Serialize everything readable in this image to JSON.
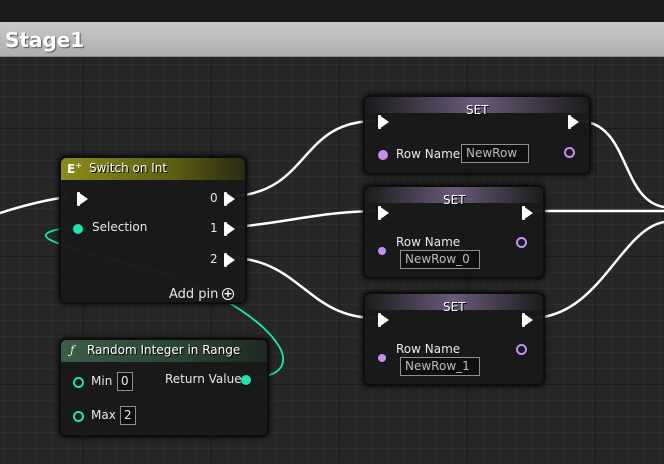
{
  "comment": {
    "title": "Stage1"
  },
  "switch_node": {
    "title": "Switch on Int",
    "icon": "switch-icon",
    "pins": [
      "0",
      "1",
      "2"
    ],
    "selection_label": "Selection",
    "add_pin_label": "Add pin",
    "add_pin_icon": "+"
  },
  "random_node": {
    "title": "Random Integer in Range",
    "icon_glyph": "ƒ",
    "min_label": "Min",
    "min_value": "0",
    "max_label": "Max",
    "max_value": "2",
    "return_label": "Return Value"
  },
  "set_nodes": [
    {
      "title": "SET",
      "row_label": "Row Name",
      "row_value": "NewRow"
    },
    {
      "title": "SET",
      "row_label": "Row Name",
      "row_value": "NewRow_0"
    },
    {
      "title": "SET",
      "row_label": "Row Name",
      "row_value": "NewRow_1"
    }
  ],
  "colors": {
    "exec_wire": "#ffffff",
    "int_pin": "#1fe3af",
    "name_pin": "#c98cf2",
    "switch_header": "#7f7f15",
    "function_header": "#2c4a37",
    "set_header": "#6a5a7a"
  }
}
